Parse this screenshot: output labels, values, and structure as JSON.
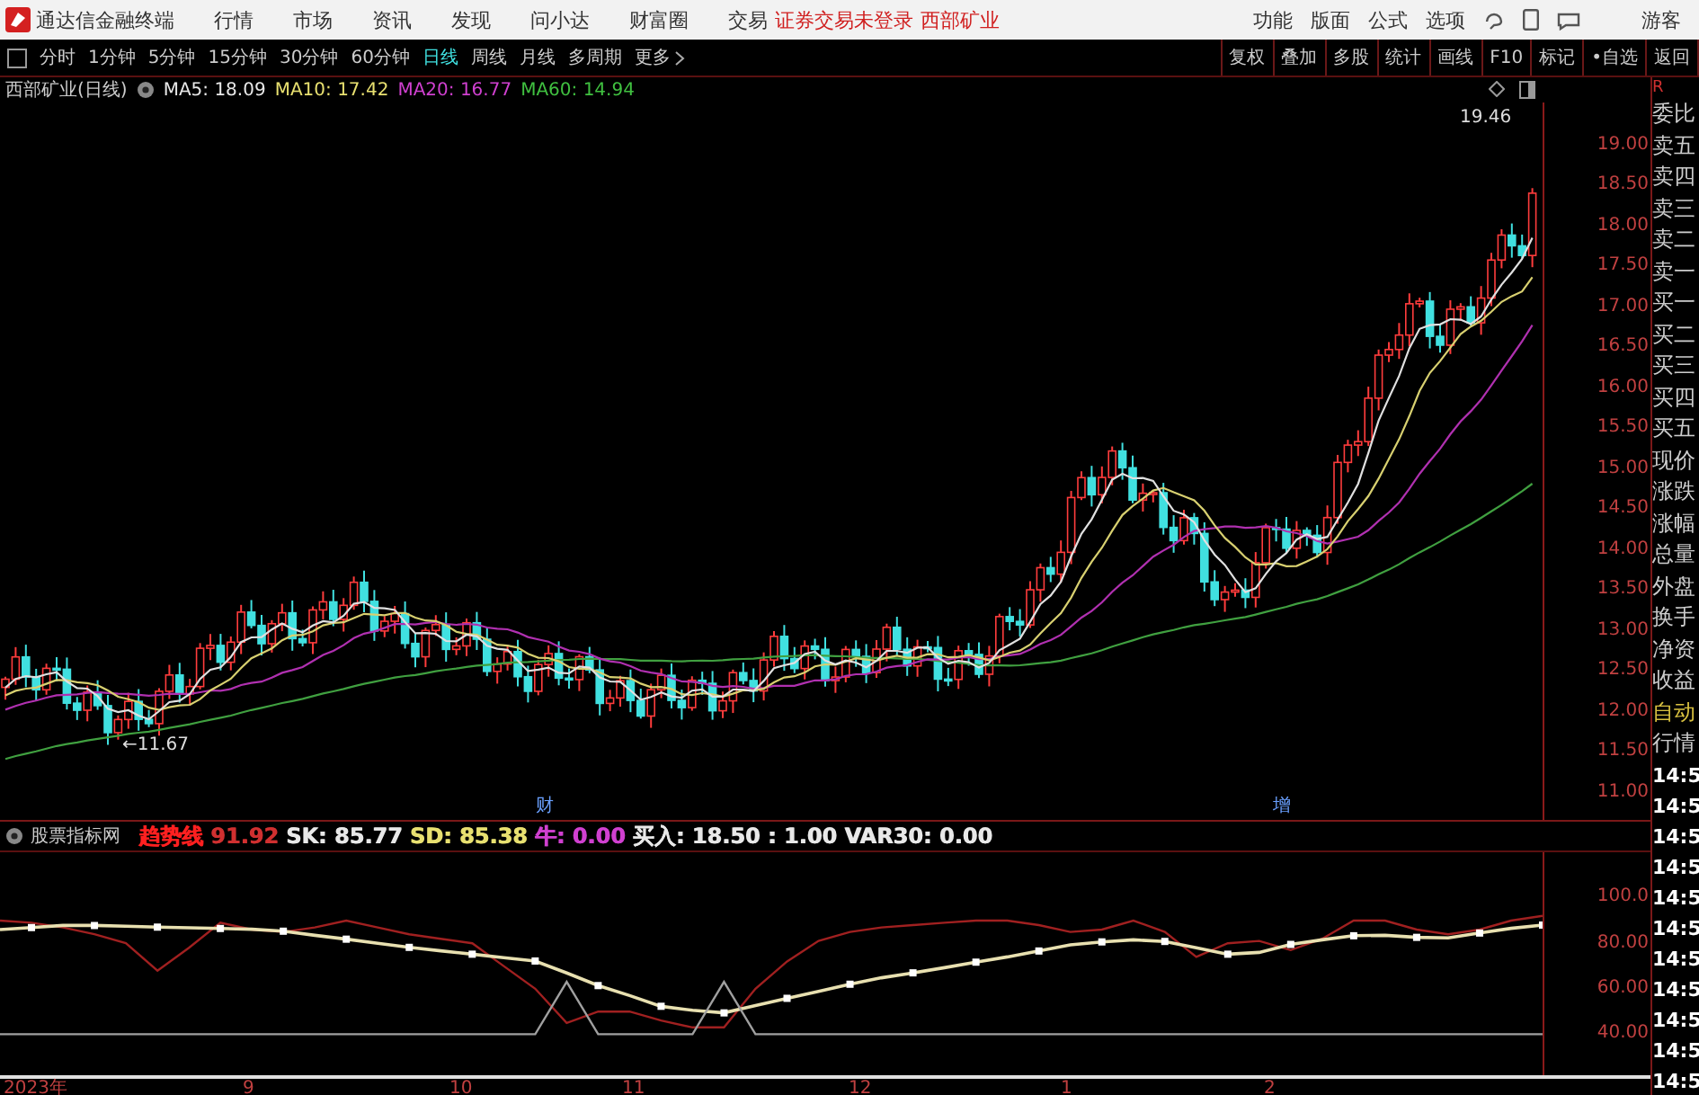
{
  "title_bar": {
    "app_name": "通达信金融终端",
    "menu": [
      "行情",
      "市场",
      "资讯",
      "发现",
      "问小达",
      "财富圈",
      "交易"
    ],
    "login_status": "证券交易未登录",
    "stock_name": "西部矿业",
    "right_menu": [
      "功能",
      "版面",
      "公式",
      "选项"
    ],
    "user": "游客"
  },
  "period_bar": {
    "periods": [
      {
        "label": "分时",
        "selected": false
      },
      {
        "label": "1分钟",
        "selected": false
      },
      {
        "label": "5分钟",
        "selected": false
      },
      {
        "label": "15分钟",
        "selected": false
      },
      {
        "label": "30分钟",
        "selected": false
      },
      {
        "label": "60分钟",
        "selected": false
      },
      {
        "label": "日线",
        "selected": true
      },
      {
        "label": "周线",
        "selected": false
      },
      {
        "label": "月线",
        "selected": false
      },
      {
        "label": "多周期",
        "selected": false
      }
    ],
    "more": "更多",
    "tools": [
      "复权",
      "叠加",
      "多股",
      "统计",
      "画线",
      "F10",
      "标记",
      "•自选",
      "返回"
    ]
  },
  "chart_header": {
    "title": "西部矿业(日线)",
    "ma": [
      {
        "label": "MA5: 18.09",
        "color": "#e8e8e8"
      },
      {
        "label": "MA10: 17.42",
        "color": "#e8e070"
      },
      {
        "label": "MA20: 16.77",
        "color": "#d040d0"
      },
      {
        "label": "MA60: 14.94",
        "color": "#40c040"
      }
    ]
  },
  "price_axis": [
    "19.00",
    "18.50",
    "18.00",
    "17.50",
    "17.00",
    "16.50",
    "16.00",
    "15.50",
    "15.00",
    "14.50",
    "14.00",
    "13.50",
    "13.00",
    "12.50",
    "12.00",
    "11.50",
    "11.00"
  ],
  "chart_labels": {
    "high": "19.46",
    "low": "←11.67",
    "events": [
      "财",
      "增"
    ]
  },
  "indicator_header": {
    "name": "股票指标网",
    "items": [
      {
        "label": "趋势线",
        "color": "#ff2020"
      },
      {
        "label": "91.92",
        "color": "#d03030"
      },
      {
        "label": "SK: 85.77",
        "color": "#e8e8e8"
      },
      {
        "label": "SD: 85.38",
        "color": "#e8e070"
      },
      {
        "label": "牛:",
        "color": "#d040d0"
      },
      {
        "label": "0.00",
        "color": "#d040d0"
      },
      {
        "label": "买入: 18.50 : 1.00 VAR30: 0.00",
        "color": "#e8e8e8"
      }
    ]
  },
  "indicator_chart": {
    "chart_data": {
      "type": "line",
      "ylim": [
        22,
        120
      ],
      "yticks": [
        {
          "value": 100,
          "label": "100.0"
        },
        {
          "value": 80,
          "label": "80.00"
        },
        {
          "value": 60,
          "label": "60.00"
        },
        {
          "value": 40,
          "label": "40.00"
        }
      ],
      "series": [
        {
          "color": "#a02020",
          "values": [
            90,
            89,
            87,
            84,
            80,
            68,
            78,
            89,
            86,
            85,
            87,
            90,
            87,
            84,
            82,
            80,
            70,
            60,
            45,
            50,
            50,
            46,
            43,
            43,
            60,
            72,
            81,
            85,
            87,
            88,
            89,
            90,
            90,
            88,
            85,
            86,
            90,
            85,
            74,
            80,
            81,
            77,
            82,
            90,
            90,
            86,
            84,
            86,
            90,
            92
          ]
        },
        {
          "color": "#e8e0b0",
          "values": [
            86,
            86.9,
            87.8,
            87.8,
            87.5,
            87.1,
            86.8,
            86.5,
            86.2,
            85.3,
            83.5,
            81.8,
            80,
            78.2,
            76.7,
            75.2,
            73.7,
            72.2,
            67,
            61.4,
            57,
            52.3,
            50.5,
            49.4,
            52.6,
            55.8,
            58.8,
            62,
            64.8,
            67,
            69.3,
            71.7,
            74,
            76.6,
            79.3,
            80.6,
            81.5,
            80.8,
            78,
            75.2,
            76,
            79.5,
            81.5,
            83.3,
            83.5,
            82.6,
            82.4,
            84.5,
            86.6,
            88
          ]
        },
        {
          "color": "#a0a0a0",
          "values": [
            40,
            40,
            40,
            40,
            40,
            40,
            40,
            40,
            40,
            40,
            40,
            40,
            40,
            40,
            40,
            40,
            40,
            40,
            63,
            40,
            40,
            40,
            40,
            63,
            40,
            40,
            40,
            40,
            40,
            40,
            40,
            40,
            40,
            40,
            40,
            40,
            40,
            40,
            40,
            40,
            40,
            40,
            40,
            40,
            40,
            40,
            40,
            40,
            40,
            40
          ]
        }
      ]
    }
  },
  "date_axis": [
    "2023年",
    "9",
    "10",
    "11",
    "12",
    "1",
    "2"
  ],
  "side_panel": {
    "header": "R",
    "labels": [
      "委比",
      "卖五",
      "卖四",
      "卖三",
      "卖二",
      "卖一",
      "买一",
      "买二",
      "买三",
      "买四",
      "买五",
      "现价",
      "涨跌",
      "涨幅",
      "总量",
      "外盘",
      "换手",
      "净资",
      "收益"
    ],
    "auto": "自动",
    "quote": "行情",
    "times": [
      "14:5",
      "14:5",
      "14:5",
      "14:5",
      "14:5",
      "14:5",
      "14:5",
      "14:5",
      "14:5",
      "14:5",
      "14:5"
    ]
  }
}
